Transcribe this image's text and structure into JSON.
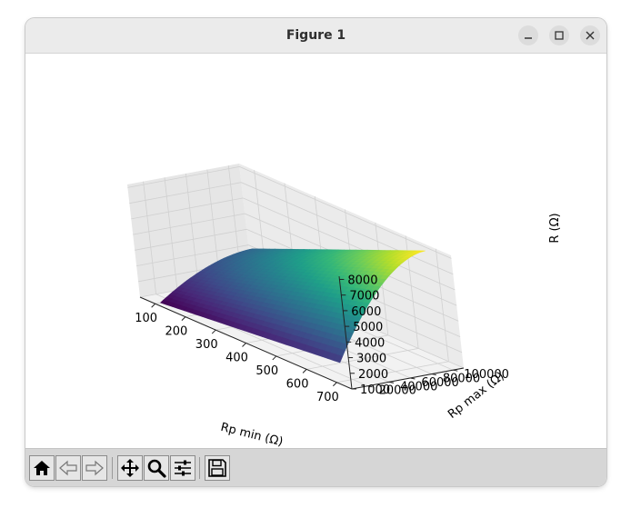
{
  "window": {
    "title": "Figure 1"
  },
  "window_controls": [
    {
      "name": "minimize-icon",
      "label": "minimize"
    },
    {
      "name": "maximize-icon",
      "label": "maximize"
    },
    {
      "name": "close-icon",
      "label": "close"
    }
  ],
  "toolbar": {
    "buttons": [
      {
        "name": "home-icon",
        "tooltip": "Home"
      },
      {
        "name": "back-arrow-icon",
        "tooltip": "Back"
      },
      {
        "name": "forward-arrow-icon",
        "tooltip": "Forward"
      },
      {
        "name": "pan-icon",
        "tooltip": "Pan"
      },
      {
        "name": "zoom-icon",
        "tooltip": "Zoom"
      },
      {
        "name": "configure-subplots-icon",
        "tooltip": "Subplots"
      },
      {
        "name": "save-icon",
        "tooltip": "Save"
      }
    ]
  },
  "chart_data": {
    "type": "surface",
    "colormap": "viridis",
    "xlabel": "Rp min (Ω)",
    "ylabel": "Rp max (Ω)",
    "zlabel": "R (Ω)",
    "xlim": [
      50,
      750
    ],
    "ylim": [
      5000,
      110000
    ],
    "zlim": [
      1000,
      8200
    ],
    "x_ticks": [
      100,
      200,
      300,
      400,
      500,
      600,
      700
    ],
    "y_ticks": [
      20000,
      40000,
      60000,
      80000,
      100000
    ],
    "z_ticks": [
      1000,
      2000,
      3000,
      4000,
      5000,
      6000,
      7000,
      8000
    ],
    "surface_corners": [
      {
        "x": 100,
        "y": 10000,
        "z": 1000
      },
      {
        "x": 700,
        "y": 10000,
        "z": 2200
      },
      {
        "x": 100,
        "y": 100000,
        "z": 3300
      },
      {
        "x": 700,
        "y": 100000,
        "z": 8200
      }
    ],
    "grid": true
  }
}
